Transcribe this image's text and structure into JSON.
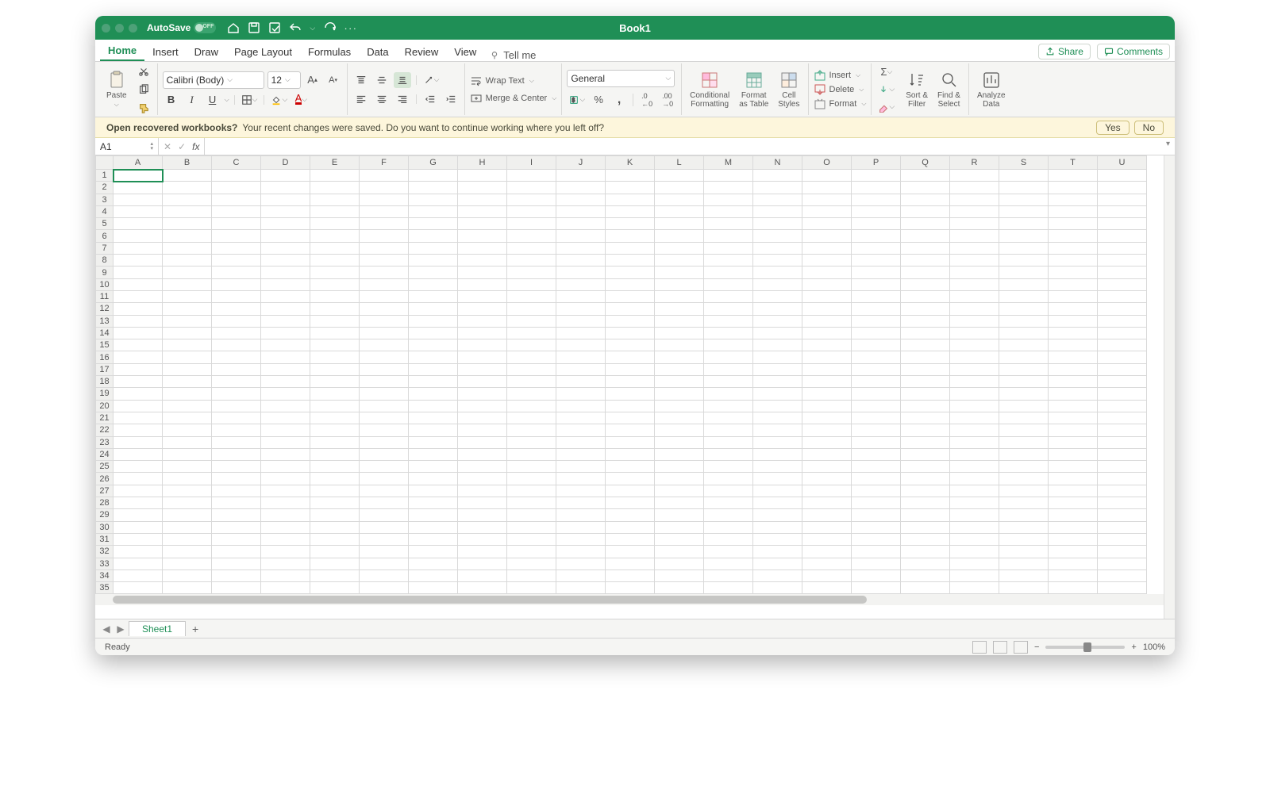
{
  "titlebar": {
    "autosave_label": "AutoSave",
    "autosave_state": "OFF",
    "title": "Book1"
  },
  "tabs": {
    "items": [
      "Home",
      "Insert",
      "Draw",
      "Page Layout",
      "Formulas",
      "Data",
      "Review",
      "View"
    ],
    "tellme": "Tell me",
    "active": "Home",
    "share": "Share",
    "comments": "Comments"
  },
  "ribbon": {
    "paste": "Paste",
    "font_name": "Calibri (Body)",
    "font_size": "12",
    "wrap_text": "Wrap Text",
    "merge_center": "Merge & Center",
    "number_format": "General",
    "conditional_formatting": "Conditional\nFormatting",
    "format_as_table": "Format\nas Table",
    "cell_styles": "Cell\nStyles",
    "insert": "Insert",
    "delete": "Delete",
    "format": "Format",
    "sort_filter": "Sort &\nFilter",
    "find_select": "Find &\nSelect",
    "analyze_data": "Analyze\nData"
  },
  "infobar": {
    "heading": "Open recovered workbooks?",
    "text": "Your recent changes were saved. Do you want to continue working where you left off?",
    "yes": "Yes",
    "no": "No"
  },
  "formula": {
    "cell_ref": "A1",
    "fx": "fx",
    "value": ""
  },
  "grid": {
    "columns": [
      "A",
      "B",
      "C",
      "D",
      "E",
      "F",
      "G",
      "H",
      "I",
      "J",
      "K",
      "L",
      "M",
      "N",
      "O",
      "P",
      "Q",
      "R",
      "S",
      "T",
      "U"
    ],
    "rows": 35,
    "selected_col": "A",
    "selected_row": 1
  },
  "sheets": {
    "active": "Sheet1"
  },
  "status": {
    "ready": "Ready",
    "zoom": "100%"
  }
}
